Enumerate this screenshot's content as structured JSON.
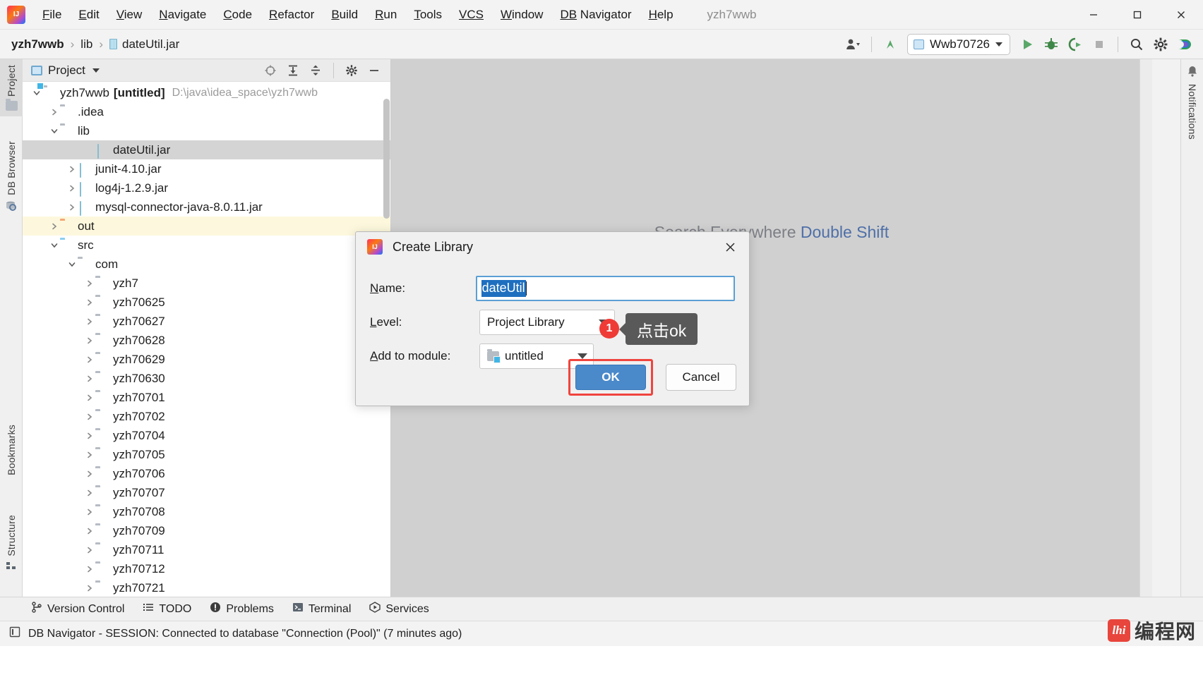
{
  "window": {
    "title": "yzh7wwb",
    "minimize_label": "minimize",
    "maximize_label": "maximize",
    "close_label": "close"
  },
  "menu": {
    "items": [
      {
        "mnemonic": "F",
        "rest": "ile"
      },
      {
        "mnemonic": "E",
        "rest": "dit"
      },
      {
        "mnemonic": "V",
        "rest": "iew"
      },
      {
        "mnemonic": "N",
        "rest": "avigate"
      },
      {
        "mnemonic": "C",
        "rest": "ode"
      },
      {
        "mnemonic": "R",
        "rest": "efactor"
      },
      {
        "mnemonic": "B",
        "rest": "uild"
      },
      {
        "mnemonic": "R",
        "rest": "un"
      },
      {
        "mnemonic": "T",
        "rest": "ools"
      },
      {
        "mnemonic": "VCS",
        "rest": ""
      },
      {
        "mnemonic": "W",
        "rest": "indow"
      },
      {
        "mnemonic": "DB",
        "rest": " Navigator"
      },
      {
        "mnemonic": "H",
        "rest": "elp"
      }
    ]
  },
  "breadcrumb": {
    "project": "yzh7wwb",
    "folder": "lib",
    "file": "dateUtil.jar",
    "separator": "›"
  },
  "toolbar": {
    "run_config": "Wwb70726",
    "buttons": [
      "user-icon",
      "updates-icon",
      "run-icon",
      "debug-icon",
      "run-coverage-icon",
      "stop-icon",
      "search-icon",
      "settings-icon",
      "ide-services-icon"
    ]
  },
  "left_strip": {
    "tabs": [
      "Project",
      "DB Browser",
      "Bookmarks",
      "Structure"
    ]
  },
  "right_strip": {
    "tabs": [
      "Notifications"
    ]
  },
  "project_panel": {
    "title": "Project",
    "header_actions": [
      "select-opened-file-icon",
      "expand-all-icon",
      "collapse-all-icon",
      "settings-icon",
      "hide-icon"
    ],
    "tree": [
      {
        "indent": 0,
        "arrow": "down",
        "icon": "module-folder",
        "label": "yzh7wwb",
        "bold_label": "[untitled]",
        "dim": "D:\\java\\idea_space\\yzh7wwb",
        "state": "normal"
      },
      {
        "indent": 1,
        "arrow": "right",
        "icon": "folder",
        "label": ".idea",
        "state": "normal"
      },
      {
        "indent": 1,
        "arrow": "down",
        "icon": "folder",
        "label": "lib",
        "state": "normal"
      },
      {
        "indent": 3,
        "arrow": "none",
        "icon": "jar",
        "label": "dateUtil.jar",
        "state": "selected"
      },
      {
        "indent": 2,
        "arrow": "right",
        "icon": "jar",
        "label": "junit-4.10.jar",
        "state": "normal"
      },
      {
        "indent": 2,
        "arrow": "right",
        "icon": "jar",
        "label": "log4j-1.2.9.jar",
        "state": "normal"
      },
      {
        "indent": 2,
        "arrow": "right",
        "icon": "jar",
        "label": "mysql-connector-java-8.0.11.jar",
        "state": "normal"
      },
      {
        "indent": 1,
        "arrow": "right",
        "icon": "folder-orange",
        "label": "out",
        "state": "highlight"
      },
      {
        "indent": 1,
        "arrow": "down",
        "icon": "folder-blue",
        "label": "src",
        "state": "normal"
      },
      {
        "indent": 2,
        "arrow": "down",
        "icon": "package",
        "label": "com",
        "state": "normal"
      },
      {
        "indent": 3,
        "arrow": "right",
        "icon": "package",
        "label": "yzh7",
        "state": "normal"
      },
      {
        "indent": 3,
        "arrow": "right",
        "icon": "package",
        "label": "yzh70625",
        "state": "normal"
      },
      {
        "indent": 3,
        "arrow": "right",
        "icon": "package",
        "label": "yzh70627",
        "state": "normal"
      },
      {
        "indent": 3,
        "arrow": "right",
        "icon": "package",
        "label": "yzh70628",
        "state": "normal"
      },
      {
        "indent": 3,
        "arrow": "right",
        "icon": "package",
        "label": "yzh70629",
        "state": "normal"
      },
      {
        "indent": 3,
        "arrow": "right",
        "icon": "package",
        "label": "yzh70630",
        "state": "normal"
      },
      {
        "indent": 3,
        "arrow": "right",
        "icon": "package",
        "label": "yzh70701",
        "state": "normal"
      },
      {
        "indent": 3,
        "arrow": "right",
        "icon": "package",
        "label": "yzh70702",
        "state": "normal"
      },
      {
        "indent": 3,
        "arrow": "right",
        "icon": "package",
        "label": "yzh70704",
        "state": "normal"
      },
      {
        "indent": 3,
        "arrow": "right",
        "icon": "package",
        "label": "yzh70705",
        "state": "normal"
      },
      {
        "indent": 3,
        "arrow": "right",
        "icon": "package",
        "label": "yzh70706",
        "state": "normal"
      },
      {
        "indent": 3,
        "arrow": "right",
        "icon": "package",
        "label": "yzh70707",
        "state": "normal"
      },
      {
        "indent": 3,
        "arrow": "right",
        "icon": "package",
        "label": "yzh70708",
        "state": "normal"
      },
      {
        "indent": 3,
        "arrow": "right",
        "icon": "package",
        "label": "yzh70709",
        "state": "normal"
      },
      {
        "indent": 3,
        "arrow": "right",
        "icon": "package",
        "label": "yzh70711",
        "state": "normal"
      },
      {
        "indent": 3,
        "arrow": "right",
        "icon": "package",
        "label": "yzh70712",
        "state": "normal"
      },
      {
        "indent": 3,
        "arrow": "right",
        "icon": "package",
        "label": "yzh70721",
        "state": "normal"
      }
    ]
  },
  "editor": {
    "hint_prefix": "Search Everywhere ",
    "hint_shortcut": "Double Shift"
  },
  "dialog": {
    "title": "Create Library",
    "close_label": "✕",
    "name_label_mnemonic": "N",
    "name_label_rest": "ame:",
    "name_value": "dateUtil",
    "level_label_mnemonic": "L",
    "level_label_rest": "evel:",
    "level_value": "Project Library",
    "module_label_mnemonic": "A",
    "module_label_rest": "dd to module:",
    "module_value": "untitled",
    "ok_label": "OK",
    "cancel_label": "Cancel",
    "highlight_color": "#f0443e",
    "ok_color": "#4a89ca"
  },
  "callout": {
    "number": "1",
    "text": "点击ok"
  },
  "tool_windows": {
    "items": [
      {
        "icon": "version-control-icon",
        "label": "Version Control"
      },
      {
        "icon": "todo-icon",
        "label": "TODO"
      },
      {
        "icon": "problems-icon",
        "label": "Problems"
      },
      {
        "icon": "terminal-icon",
        "label": "Terminal"
      },
      {
        "icon": "services-icon",
        "label": "Services"
      }
    ]
  },
  "status_bar": {
    "icon": "console-icon",
    "text": "DB Navigator  - SESSION: Connected to database \"Connection (Pool)\" (7 minutes ago)"
  },
  "watermark": {
    "badge": "lhi",
    "text": "编程网"
  }
}
